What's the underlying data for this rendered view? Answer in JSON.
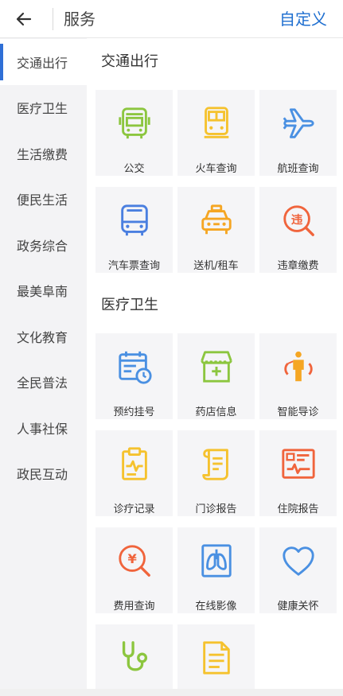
{
  "header": {
    "title": "服务",
    "custom_label": "自定义"
  },
  "sidebar": {
    "items": [
      {
        "label": "交通出行",
        "active": true
      },
      {
        "label": "医疗卫生"
      },
      {
        "label": "生活缴费"
      },
      {
        "label": "便民生活"
      },
      {
        "label": "政务综合"
      },
      {
        "label": "最美阜南"
      },
      {
        "label": "文化教育"
      },
      {
        "label": "全民普法"
      },
      {
        "label": "人事社保"
      },
      {
        "label": "政民互动"
      }
    ]
  },
  "sections": [
    {
      "title": "交通出行",
      "tiles": [
        {
          "label": "公交",
          "icon": "bus-icon",
          "color": "#8cc63f"
        },
        {
          "label": "火车查询",
          "icon": "train-icon",
          "color": "#f5c22e"
        },
        {
          "label": "航班查询",
          "icon": "airplane-icon",
          "color": "#4a90e2"
        },
        {
          "label": "汽车票查询",
          "icon": "coach-icon",
          "color": "#4a7fe0"
        },
        {
          "label": "送机/租车",
          "icon": "taxi-icon",
          "color": "#f5a623"
        },
        {
          "label": "违章缴费",
          "icon": "violation-icon",
          "color": "#f0643c",
          "glyph": "违"
        }
      ]
    },
    {
      "title": "医疗卫生",
      "tiles": [
        {
          "label": "预约挂号",
          "icon": "calendar-clock-icon",
          "color": "#4a90e2"
        },
        {
          "label": "药店信息",
          "icon": "pharmacy-icon",
          "color": "#8cc63f"
        },
        {
          "label": "智能导诊",
          "icon": "guide-person-icon",
          "color": "#f5a623"
        },
        {
          "label": "诊疗记录",
          "icon": "clipboard-pulse-icon",
          "color": "#f5c22e"
        },
        {
          "label": "门诊报告",
          "icon": "scroll-report-icon",
          "color": "#f5c22e"
        },
        {
          "label": "住院报告",
          "icon": "hospital-report-icon",
          "color": "#f0643c"
        },
        {
          "label": "费用查询",
          "icon": "yuan-search-icon",
          "color": "#f0643c",
          "glyph": "¥"
        },
        {
          "label": "在线影像",
          "icon": "xray-icon",
          "color": "#4a90e2"
        },
        {
          "label": "健康关怀",
          "icon": "heart-icon",
          "color": "#4a90e2"
        },
        {
          "label": "",
          "icon": "stethoscope-icon",
          "color": "#8cc63f"
        },
        {
          "label": "",
          "icon": "document-icon",
          "color": "#f5c22e"
        }
      ]
    }
  ]
}
